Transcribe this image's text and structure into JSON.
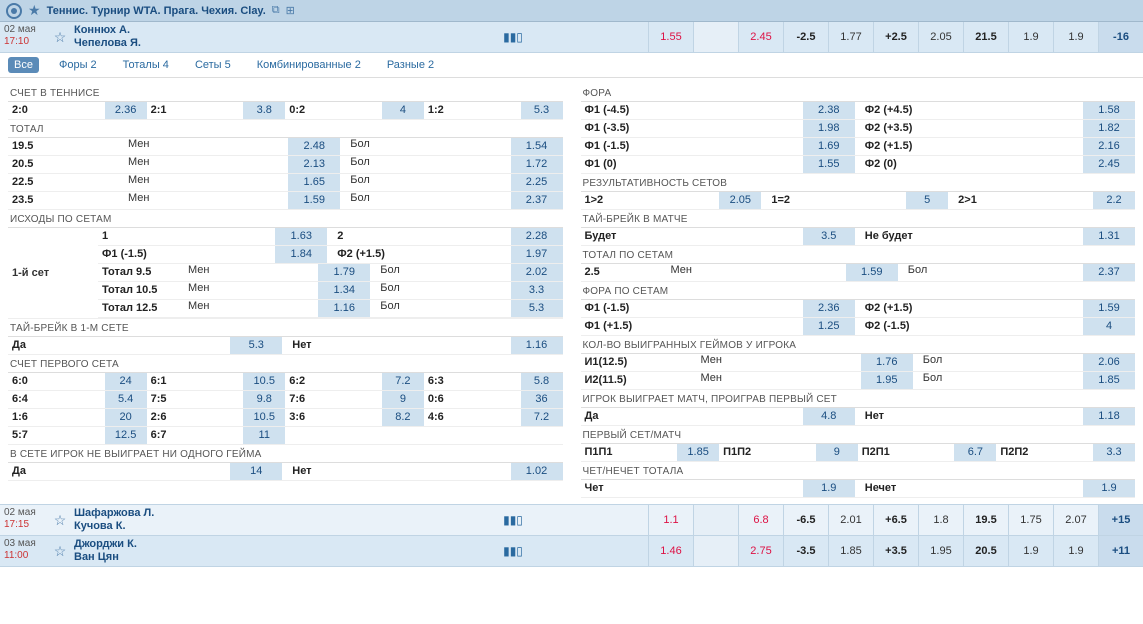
{
  "header": {
    "title": "Теннис. Турнир WTA. Прага. Чехия. Clay."
  },
  "match": {
    "date": "02 мая",
    "time": "17:10",
    "p1": "Коннюх А.",
    "p2": "Чепелова Я.",
    "odds": [
      "1.55",
      "",
      "2.45",
      "-2.5",
      "1.77",
      "+2.5",
      "2.05",
      "21.5",
      "1.9",
      "1.9",
      "-16"
    ]
  },
  "tabs": [
    "Все",
    "Форы 2",
    "Тоталы 4",
    "Сеты 5",
    "Комбинированные 2",
    "Разные 2"
  ],
  "left": {
    "score_head": "СЧЕТ В ТЕННИСЕ",
    "score": [
      [
        "2:0",
        "2.36"
      ],
      [
        "2:1",
        "3.8"
      ],
      [
        "0:2",
        "4"
      ],
      [
        "1:2",
        "5.3"
      ]
    ],
    "total_head": "ТОТАЛ",
    "totals": [
      [
        "19.5",
        "Мен",
        "2.48",
        "Бол",
        "1.54"
      ],
      [
        "20.5",
        "Мен",
        "2.13",
        "Бол",
        "1.72"
      ],
      [
        "22.5",
        "Мен",
        "1.65",
        "Бол",
        "2.25"
      ],
      [
        "23.5",
        "Мен",
        "1.59",
        "Бол",
        "2.37"
      ]
    ],
    "bysets_head": "ИСХОДЫ ПО СЕТАМ",
    "set1_label": "1-й сет",
    "set1_rows": [
      [
        "1",
        "1.63",
        "2",
        "2.28"
      ],
      [
        "Ф1 (-1.5)",
        "1.84",
        "Ф2 (+1.5)",
        "1.97"
      ],
      [
        "Тотал 9.5",
        "Мен",
        "1.79",
        "Бол",
        "2.02"
      ],
      [
        "Тотал 10.5",
        "Мен",
        "1.34",
        "Бол",
        "3.3"
      ],
      [
        "Тотал 12.5",
        "Мен",
        "1.16",
        "Бол",
        "5.3"
      ]
    ],
    "tb1_head": "ТАЙ-БРЕЙК В 1-М СЕТЕ",
    "tb1": [
      "Да",
      "5.3",
      "Нет",
      "1.16"
    ],
    "firstset_head": "СЧЕТ ПЕРВОГО СЕТА",
    "firstset": [
      [
        "6:0",
        "24",
        "6:1",
        "10.5",
        "6:2",
        "7.2",
        "6:3",
        "5.8"
      ],
      [
        "6:4",
        "5.4",
        "7:5",
        "9.8",
        "7:6",
        "9",
        "0:6",
        "36"
      ],
      [
        "1:6",
        "20",
        "2:6",
        "10.5",
        "3:6",
        "8.2",
        "4:6",
        "7.2"
      ],
      [
        "5:7",
        "12.5",
        "6:7",
        "11",
        "",
        "",
        "",
        ""
      ]
    ],
    "nogame_head": "В СЕТЕ ИГРОК НЕ ВЫИГРАЕТ НИ ОДНОГО ГЕЙМА",
    "nogame": [
      "Да",
      "14",
      "Нет",
      "1.02"
    ]
  },
  "right": {
    "fora_head": "ФОРА",
    "fora": [
      [
        "Ф1 (-4.5)",
        "2.38",
        "Ф2 (+4.5)",
        "1.58"
      ],
      [
        "Ф1 (-3.5)",
        "1.98",
        "Ф2 (+3.5)",
        "1.82"
      ],
      [
        "Ф1 (-1.5)",
        "1.69",
        "Ф2 (+1.5)",
        "2.16"
      ],
      [
        "Ф1 (0)",
        "1.55",
        "Ф2 (0)",
        "2.45"
      ]
    ],
    "setres_head": "РЕЗУЛЬТАТИВНОСТЬ СЕТОВ",
    "setres": [
      [
        "1>2",
        "2.05"
      ],
      [
        "1=2",
        "5"
      ],
      [
        "2>1",
        "2.2"
      ]
    ],
    "tb_head": "ТАЙ-БРЕЙК В МАТЧЕ",
    "tb": [
      "Будет",
      "3.5",
      "Не будет",
      "1.31"
    ],
    "totalsets_head": "ТОТАЛ ПО СЕТАМ",
    "totalsets": [
      "2.5",
      "Мен",
      "1.59",
      "Бол",
      "2.37"
    ],
    "forasets_head": "ФОРА ПО СЕТАМ",
    "forasets": [
      [
        "Ф1 (-1.5)",
        "2.36",
        "Ф2 (+1.5)",
        "1.59"
      ],
      [
        "Ф1 (+1.5)",
        "1.25",
        "Ф2 (-1.5)",
        "4"
      ]
    ],
    "games_head": "КОЛ-ВО ВЫИГРАННЫХ ГЕЙМОВ У ИГРОКА",
    "games": [
      [
        "И1(12.5)",
        "Мен",
        "1.76",
        "Бол",
        "2.06"
      ],
      [
        "И2(11.5)",
        "Мен",
        "1.95",
        "Бол",
        "1.85"
      ]
    ],
    "lose1_head": "ИГРОК ВЫИГРАЕТ МАТЧ, ПРОИГРАВ ПЕРВЫЙ СЕТ",
    "lose1": [
      "Да",
      "4.8",
      "Нет",
      "1.18"
    ],
    "firstmatch_head": "ПЕРВЫЙ СЕТ/МАТЧ",
    "firstmatch": [
      [
        "П1П1",
        "1.85"
      ],
      [
        "П1П2",
        "9"
      ],
      [
        "П2П1",
        "6.7"
      ],
      [
        "П2П2",
        "3.3"
      ]
    ],
    "odd_head": "ЧЕТ/НЕЧЕТ ТОТАЛА",
    "odd": [
      "Чет",
      "1.9",
      "Нечет",
      "1.9"
    ]
  },
  "bottom": [
    {
      "date": "02 мая",
      "time": "17:15",
      "p1": "Шафаржова Л.",
      "p2": "Кучова К.",
      "odds": [
        "1.1",
        "",
        "6.8",
        "-6.5",
        "2.01",
        "+6.5",
        "1.8",
        "19.5",
        "1.75",
        "2.07",
        "+15"
      ]
    },
    {
      "date": "03 мая",
      "time": "11:00",
      "p1": "Джорджи К.",
      "p2": "Ван Цян",
      "odds": [
        "1.46",
        "",
        "2.75",
        "-3.5",
        "1.85",
        "+3.5",
        "1.95",
        "20.5",
        "1.9",
        "1.9",
        "+11"
      ]
    }
  ]
}
